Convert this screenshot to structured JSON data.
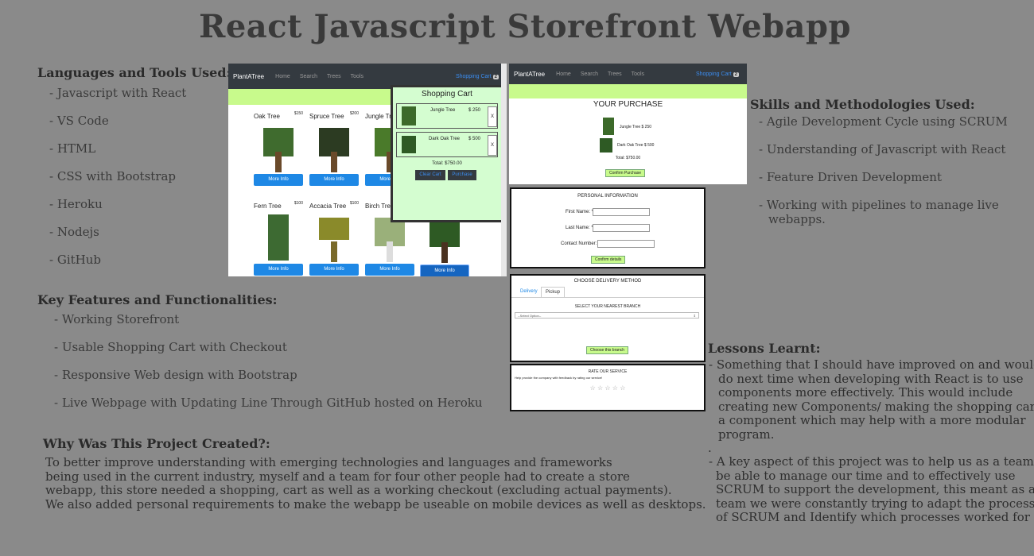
{
  "title": "React Javascript Storefront Webapp",
  "languages": {
    "heading": "Languages and Tools Used:",
    "items": [
      "- Javascript with React",
      "- VS Code",
      "- HTML",
      "- CSS with Bootstrap",
      "- Heroku",
      "- Nodejs",
      "- GitHub"
    ]
  },
  "features": {
    "heading": "Key Features and Functionalities:",
    "items": [
      "- Working Storefront",
      "- Usable Shopping Cart with Checkout",
      "- Responsive Web design with Bootstrap",
      "- Live Webpage with Updating Line Through GitHub hosted on Heroku"
    ]
  },
  "why": {
    "heading": "Why Was This Project Created?:",
    "lines": [
      "To better improve understanding with emerging technologies and languages and frameworks",
      "being used in the current industry, myself and a team for four other people had to create a store",
      "webapp, this store needed a shopping, cart as well as a working checkout (excluding actual payments).",
      "We also added personal requirements to make the webapp be useable on mobile devices as well as desktops."
    ]
  },
  "skills": {
    "heading": "Skills and Methodologies Used:",
    "items": [
      "- Agile Development Cycle using SCRUM",
      "- Understanding of Javascript with React",
      "- Feature Driven Development",
      "- Working with pipelines to manage live",
      "webapps."
    ]
  },
  "lessons": {
    "heading": "Lessons Learnt:",
    "p1": [
      "- Something that I should have improved on and would",
      "do next time when developing with React is to use",
      "components more effectively. This would include",
      "creating new Components/ making the shopping cart",
      "a component which may help with a more modular",
      "program."
    ],
    "dot": ".",
    "p2": [
      "- A key aspect of this project was to help us as a team to",
      "be able to manage our time and to effectively use",
      "SCRUM to support the development, this meant as a",
      "team we were constantly trying to adapt the processes",
      "of SCRUM and Identify which processes worked for us."
    ]
  },
  "store": {
    "brand": "PlantATree",
    "nav": [
      "Home",
      "Search",
      "Trees",
      "Tools"
    ],
    "cart_link": "Shopping Cart",
    "cart_count": "2",
    "products": [
      {
        "name": "Oak Tree",
        "price": "$150",
        "button": "More Info"
      },
      {
        "name": "Spruce Tree",
        "price": "$200",
        "button": "More Info"
      },
      {
        "name": "Jungle Tree",
        "price": "",
        "button": "More Info"
      },
      {
        "name": "",
        "price": "",
        "button": "More Info"
      },
      {
        "name": "Fern Tree",
        "price": "$100",
        "button": "More Info"
      },
      {
        "name": "Accacia Tree",
        "price": "$100",
        "button": "More Info"
      },
      {
        "name": "Birch Tree",
        "price": "",
        "button": "More Info"
      },
      {
        "name": "",
        "price": "",
        "button": "More Info"
      }
    ],
    "cart": {
      "title": "Shopping Cart",
      "items": [
        {
          "name": "Jungle Tree",
          "price": "$ 250",
          "remove": "X"
        },
        {
          "name": "Dark Oak Tree",
          "price": "$ 500",
          "remove": "X"
        }
      ],
      "total": "Total: $750.00",
      "clear": "Clear Cart",
      "purchase": "Purchase"
    }
  },
  "purchase": {
    "brand": "PlantATree",
    "nav": [
      "Home",
      "Search",
      "Trees",
      "Tools"
    ],
    "cart_link": "Shopping Cart",
    "cart_count": "2",
    "heading": "YOUR PURCHASE",
    "items": [
      "Jungle Tree $ 250",
      "Dark Oak Tree $ 500"
    ],
    "total": "Total: $750.00",
    "confirm": "Confirm Purchase"
  },
  "personal": {
    "heading": "PERSONAL INFORMATION",
    "first": "First Name: *",
    "last": "Last Name: *",
    "contact": "Contact Number: *",
    "confirm": "Confirm details"
  },
  "delivery": {
    "heading": "CHOOSE DELIVERY METHOD",
    "tabs": [
      "Delivery",
      "Pickup"
    ],
    "branch_heading": "SELECT YOUR NEAREST BRANCH",
    "select": "--Select Option--",
    "choose": "Choose this branch"
  },
  "rate": {
    "heading": "RATE OUR SERVICE",
    "text": "Help provide the company with feedback by rating our service!",
    "stars": "☆ ☆ ☆ ☆ ☆"
  }
}
